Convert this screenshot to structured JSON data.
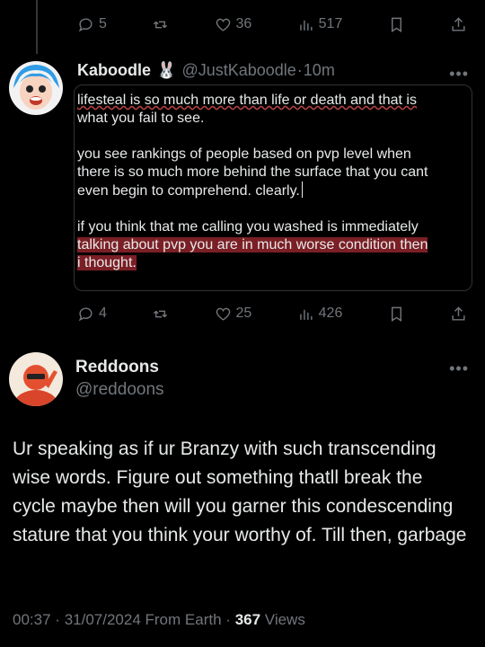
{
  "top_actions": {
    "replies": "5",
    "likes": "36",
    "views": "517"
  },
  "quoted": {
    "name": "Kaboodle",
    "emoji": "🐰",
    "handle": "@JustKaboodle",
    "sep": "·",
    "time": "10m",
    "line1": "lifesteal is so much more than life or death and that is",
    "line2": "what you fail to see.",
    "para2_a": "you see rankings of people based on pvp level when",
    "para2_b": "there is so much more behind the surface that you cant",
    "para2_c": "even begin to comprehend. clearly.",
    "para3_a": "if you think that me calling you washed is immediately",
    "para3_b": "talking about pvp you are in much worse condition then",
    "para3_c": "i thought.",
    "actions": {
      "replies": "4",
      "likes": "25",
      "views": "426"
    }
  },
  "reply": {
    "name": "Reddoons",
    "handle": "@reddoons",
    "text": "Ur speaking as if ur Branzy with such transcending wise words. Figure out something thatll break the cycle maybe then will you garner this condescending stature that you think your worthy of. Till then, garbage",
    "time": "00:37",
    "sep1": "·",
    "date": "31/07/2024",
    "source": "From Earth",
    "sep2": "·",
    "views_count": "367",
    "views_label": "Views"
  },
  "more_label": "•••",
  "colors": {
    "bg": "#000000",
    "text": "#e7e9ea",
    "muted": "#71767b",
    "highlight": "#7a1f25"
  }
}
